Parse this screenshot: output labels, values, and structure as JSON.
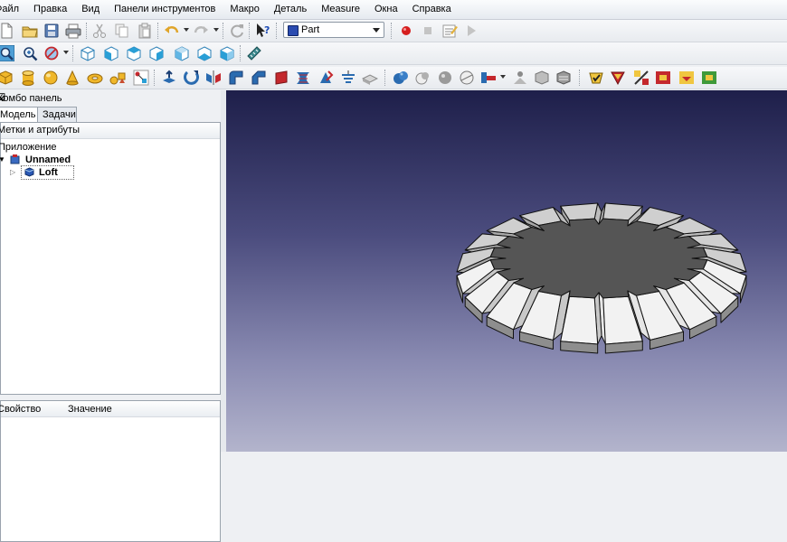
{
  "menubar": {
    "items": [
      "Файл",
      "Правка",
      "Вид",
      "Панели инструментов",
      "Макро",
      "Деталь",
      "Measure",
      "Окна",
      "Справка"
    ]
  },
  "workbench_selector": {
    "value": "Part",
    "icon": "part-workbench-icon"
  },
  "combo_panel": {
    "title": "Комбо панель",
    "tabs": [
      "Модель",
      "Задачи"
    ],
    "tree_header": "Метки и атрибуты",
    "tree": {
      "root_label": "Приложение",
      "document": "Unnamed",
      "object": "Loft"
    },
    "property_columns": [
      "Свойство",
      "Значение"
    ]
  },
  "viewport": {
    "background_top": "#1e1f4a",
    "background_bottom": "#b3b4cc",
    "model": "bevel-gear-loft"
  },
  "colors": {
    "accent_blue": "#2a4bb0",
    "record_red": "#d61f1f",
    "gear_top": "#555555",
    "gear_side": "#d9d9d9"
  }
}
